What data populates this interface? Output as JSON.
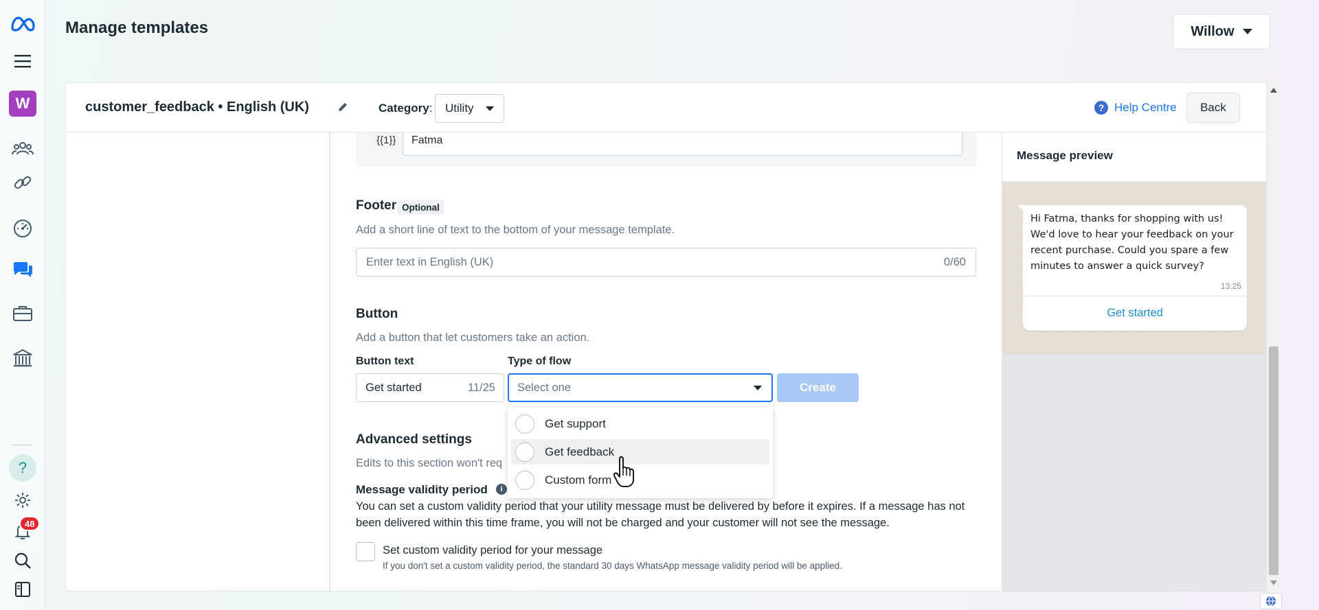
{
  "header": {
    "title": "Manage templates",
    "account": "Willow"
  },
  "sidebar": {
    "workspace_initial": "W",
    "help_glyph": "?",
    "notifications_count": "48",
    "icons": [
      "meta-logo-icon",
      "menu-icon",
      "people-icon",
      "link-icon",
      "gauge-icon",
      "chat-icon",
      "briefcase-icon",
      "bank-icon",
      "help-icon",
      "gear-icon",
      "bell-icon",
      "search-icon",
      "sidebar-toggle-icon"
    ]
  },
  "template": {
    "name": "customer_feedback • English (UK)",
    "category_label": "Category",
    "category_colon": ":",
    "category_value": "Utility",
    "help_label": "Help Centre",
    "back_label": "Back"
  },
  "variables": {
    "tag": "{{1}}",
    "value": "Fatma"
  },
  "footer": {
    "title": "Footer",
    "optional": "Optional",
    "description": "Add a short line of text to the bottom of your message template.",
    "placeholder": "Enter text in English (UK)",
    "counter": "0/60"
  },
  "button_section": {
    "title": "Button",
    "description": "Add a button that let customers take an action.",
    "button_text_label": "Button text",
    "button_text_value": "Get started",
    "button_text_counter": "11/25",
    "flow_label": "Type of flow",
    "flow_placeholder": "Select one",
    "create_label": "Create",
    "flow_options": [
      {
        "label": "Get support"
      },
      {
        "label": "Get feedback"
      },
      {
        "label": "Custom form"
      }
    ]
  },
  "advanced": {
    "title": "Advanced settings",
    "description": "Edits to this section won't req",
    "validity_title": "Message validity period",
    "validity_text": "You can set a custom validity period that your utility message must be delivered by before it expires. If a message has not been delivered within this time frame, you will not be charged and your customer will not see the message.",
    "checkbox_label": "Set custom validity period for your message",
    "checkbox_hint": "If you don't set a custom validity period, the standard 30 days WhatsApp message validity period will be applied."
  },
  "preview": {
    "title": "Message preview",
    "message": "Hi Fatma, thanks for shopping with us! We'd love to hear your feedback on your recent purchase. Could you spare a few minutes to answer a quick survey?",
    "time": "13:25",
    "button": "Get started"
  },
  "colors": {
    "accent": "#1877f2",
    "workspace": "#a43fbf",
    "badge": "#e0262f",
    "create_disabled": "#a9c8f4"
  }
}
